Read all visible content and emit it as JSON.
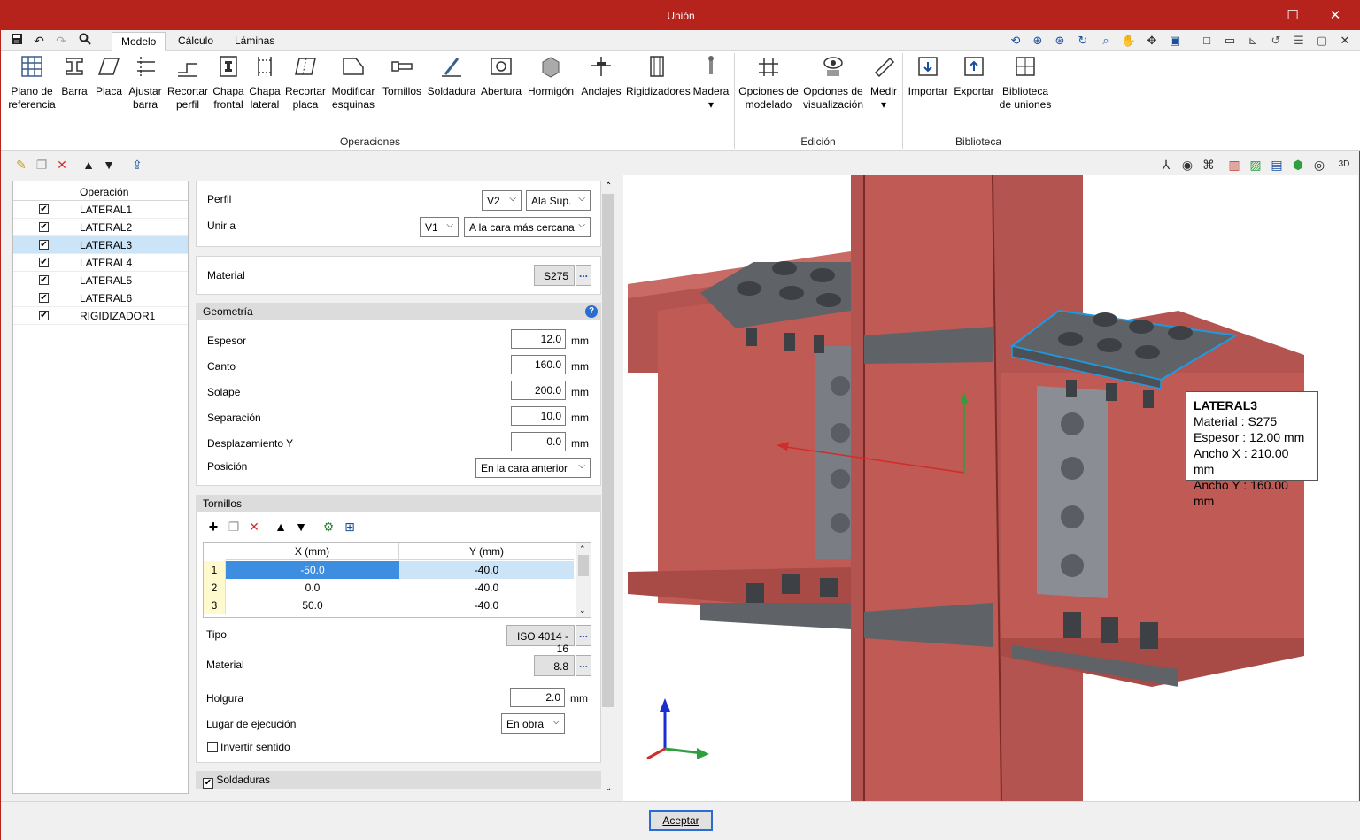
{
  "window": {
    "title": "Unión",
    "minimize": "☐",
    "close": "✕"
  },
  "tabs": [
    {
      "label": "Modelo"
    },
    {
      "label": "Cálculo"
    },
    {
      "label": "Láminas"
    }
  ],
  "ribbon": {
    "operaciones": [
      {
        "label1": "Plano de",
        "label2": "referencia",
        "icon": "grid-icon"
      },
      {
        "label1": "Barra",
        "label2": "",
        "icon": "beam-icon"
      },
      {
        "label1": "Placa",
        "label2": "",
        "icon": "plate-icon"
      },
      {
        "label1": "Ajustar",
        "label2": "barra",
        "icon": "adjust-bar-icon"
      },
      {
        "label1": "Recortar",
        "label2": "perfil",
        "icon": "cut-profile-icon"
      },
      {
        "label1": "Chapa",
        "label2": "frontal",
        "icon": "front-plate-icon"
      },
      {
        "label1": "Chapa",
        "label2": "lateral",
        "icon": "side-plate-icon"
      },
      {
        "label1": "Recortar",
        "label2": "placa",
        "icon": "cut-plate-icon"
      },
      {
        "label1": "Modificar",
        "label2": "esquinas",
        "icon": "corners-icon"
      },
      {
        "label1": "Tornillos",
        "label2": "",
        "icon": "bolts-icon"
      },
      {
        "label1": "Soldadura",
        "label2": "",
        "icon": "weld-icon"
      },
      {
        "label1": "Abertura",
        "label2": "",
        "icon": "opening-icon"
      },
      {
        "label1": "Hormigón",
        "label2": "",
        "icon": "concrete-icon"
      },
      {
        "label1": "Anclajes",
        "label2": "",
        "icon": "anchors-icon"
      },
      {
        "label1": "Rigidizadores",
        "label2": "",
        "icon": "stiffeners-icon"
      },
      {
        "label1": "Madera",
        "label2": "▾",
        "icon": "wood-icon"
      }
    ],
    "edicion": [
      {
        "label1": "Opciones de",
        "label2": "modelado",
        "icon": "modeling-options-icon"
      },
      {
        "label1": "Opciones de",
        "label2": "visualización",
        "icon": "view-options-icon"
      },
      {
        "label1": "Medir",
        "label2": "▾",
        "icon": "measure-icon"
      }
    ],
    "biblioteca": [
      {
        "label1": "Importar",
        "label2": "",
        "icon": "import-icon"
      },
      {
        "label1": "Exportar",
        "label2": "",
        "icon": "export-icon"
      },
      {
        "label1": "Biblioteca",
        "label2": "de uniones",
        "icon": "library-icon"
      }
    ],
    "groups": {
      "operaciones": "Operaciones",
      "edicion": "Edición",
      "biblioteca": "Biblioteca"
    }
  },
  "operations": {
    "header": "Operación",
    "items": [
      {
        "name": "LATERAL1",
        "checked": "✔"
      },
      {
        "name": "LATERAL2",
        "checked": "✔"
      },
      {
        "name": "LATERAL3",
        "checked": "✔"
      },
      {
        "name": "LATERAL4",
        "checked": "✔"
      },
      {
        "name": "LATERAL5",
        "checked": "✔"
      },
      {
        "name": "LATERAL6",
        "checked": "✔"
      },
      {
        "name": "RIGIDIZADOR1",
        "checked": "✔"
      }
    ]
  },
  "props": {
    "perfil_label": "Perfil",
    "perfil_value": "V2",
    "perfil_ala": "Ala Sup.",
    "unir_label": "Unir a",
    "unir_value": "V1",
    "unir_cara": "A la cara más cercana",
    "material_label": "Material",
    "material_value": "S275",
    "geometria_header": "Geometría",
    "espesor_label": "Espesor",
    "espesor": "12.0",
    "canto_label": "Canto",
    "canto": "160.0",
    "solape_label": "Solape",
    "solape": "200.0",
    "separacion_label": "Separación",
    "separacion": "10.0",
    "desplaz_label": "Desplazamiento Y",
    "desplaz": "0.0",
    "unit": "mm",
    "posicion_label": "Posición",
    "posicion": "En la cara anterior",
    "tornillos_header": "Tornillos",
    "grid_x": "X (mm)",
    "grid_y": "Y (mm)",
    "rows": [
      {
        "i": "1",
        "x": "-50.0",
        "y": "-40.0"
      },
      {
        "i": "2",
        "x": "0.0",
        "y": "-40.0"
      },
      {
        "i": "3",
        "x": "50.0",
        "y": "-40.0"
      }
    ],
    "tipo_label": "Tipo",
    "tipo": "ISO 4014 - 16",
    "bmaterial_label": "Material",
    "bmaterial": "8.8",
    "holgura_label": "Holgura",
    "holgura": "2.0",
    "lugar_label": "Lugar de ejecución",
    "lugar": "En obra",
    "invertir_label": "Invertir sentido",
    "soldaduras_label": "Soldaduras"
  },
  "tooltip": {
    "title": "LATERAL3",
    "l1": "Material  : S275",
    "l2": "Espesor   : 12.00 mm",
    "l3": "Ancho X : 210.00 mm",
    "l4": "Ancho Y : 160.00 mm"
  },
  "buttons": {
    "accept": "Aceptar",
    "dots": "..."
  },
  "colors": {
    "steel": "#c05a55",
    "plate": "#5f6368",
    "accent": "#b5231c",
    "highlight": "#1e9be0"
  }
}
